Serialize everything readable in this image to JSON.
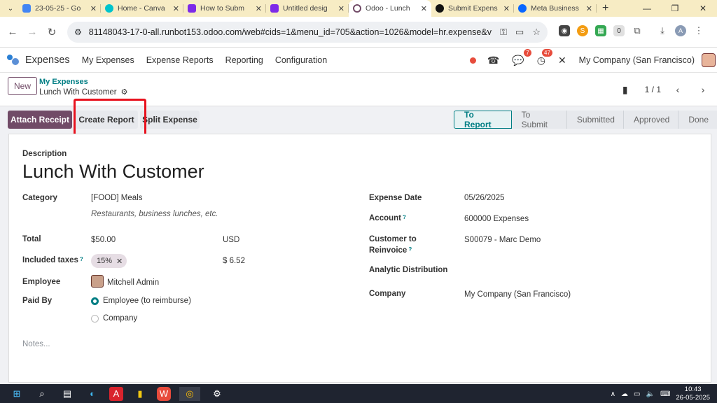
{
  "browser": {
    "tabs": [
      {
        "title": "23-05-25 - Go",
        "color": "#4285f4"
      },
      {
        "title": "Home - Canva",
        "color": "#00c4cc"
      },
      {
        "title": "How to Subm",
        "color": "#7d2ae8"
      },
      {
        "title": "Untitled desig",
        "color": "#7d2ae8"
      },
      {
        "title": "Odoo - Lunch",
        "color": "#714b67"
      },
      {
        "title": "Submit Expens",
        "color": "#111111"
      },
      {
        "title": "Meta Business",
        "color": "#0866ff"
      }
    ],
    "url": "81148043-17-0-all.runbot153.odoo.com/web#cids=1&menu_id=705&action=1026&model=hr.expense&view_...",
    "downloads_badge": "0",
    "profile_initial": "A"
  },
  "odoo_nav": {
    "app_name": "Expenses",
    "menu": [
      "My Expenses",
      "Expense Reports",
      "Reporting",
      "Configuration"
    ],
    "messages_badge": "7",
    "activities_badge": "47",
    "company": "My Company (San Francisco)"
  },
  "control_panel": {
    "new_label": "New",
    "breadcrumb_parent": "My Expenses",
    "breadcrumb_current": "Lunch With Customer",
    "pager": "1 / 1"
  },
  "actions": {
    "attach": "Attach Receipt",
    "create": "Create Report",
    "split": "Split Expense"
  },
  "stages": [
    "To Report",
    "To Submit",
    "Submitted",
    "Approved",
    "Done"
  ],
  "form": {
    "description_label": "Description",
    "title": "Lunch With Customer",
    "category_label": "Category",
    "category_value": "[FOOD] Meals",
    "category_hint": "Restaurants, business lunches, etc.",
    "total_label": "Total",
    "total_value": "$50.00",
    "currency": "USD",
    "taxes_label": "Included taxes",
    "tax_tag": "15%",
    "tax_amount": "$ 6.52",
    "employee_label": "Employee",
    "employee_value": "Mitchell Admin",
    "paid_by_label": "Paid By",
    "paid_by_options": [
      "Employee (to reimburse)",
      "Company"
    ],
    "expense_date_label": "Expense Date",
    "expense_date_value": "05/26/2025",
    "account_label": "Account",
    "account_value": "600000 Expenses",
    "customer_label_1": "Customer to",
    "customer_label_2": "Reinvoice",
    "customer_value": "S00079 - Marc Demo",
    "analytic_label": "Analytic Distribution",
    "company_label": "Company",
    "company_value": "My Company (San Francisco)",
    "notes_placeholder": "Notes..."
  },
  "taskbar": {
    "time": "10:43",
    "date": "26-05-2025"
  }
}
